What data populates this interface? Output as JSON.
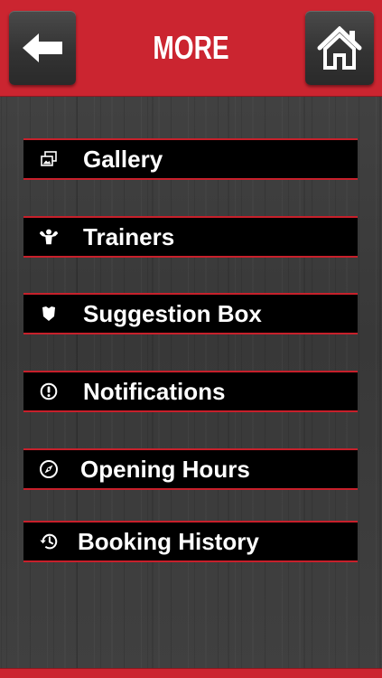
{
  "header": {
    "title": "MORE",
    "back_icon": "arrow-left-icon",
    "home_icon": "home-icon",
    "accent": "#cb2530"
  },
  "menu": {
    "items": [
      {
        "label": "Gallery",
        "icon": "gallery-icon"
      },
      {
        "label": "Trainers",
        "icon": "muscle-icon"
      },
      {
        "label": "Suggestion Box",
        "icon": "shield-icon"
      },
      {
        "label": "Notifications",
        "icon": "exclamation-circle-icon"
      },
      {
        "label": "Opening Hours",
        "icon": "compass-icon"
      },
      {
        "label": "Booking History",
        "icon": "history-icon"
      }
    ],
    "item_background": "#000000",
    "item_border": "#c7202b"
  }
}
